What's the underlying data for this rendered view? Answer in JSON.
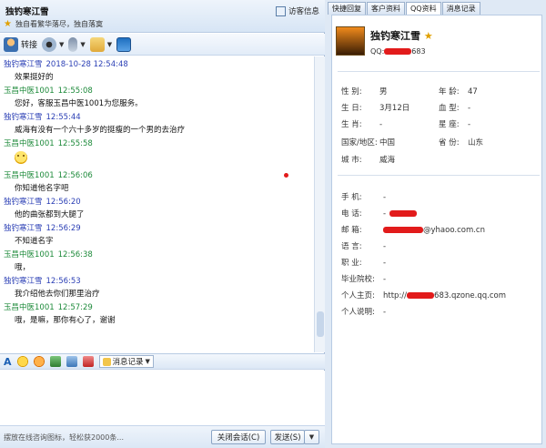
{
  "window": {
    "title": "独钓寒江雪",
    "signature": "独自看繁华落尽，独自落寞",
    "visitor_label": "访客信息"
  },
  "toolbar": {
    "transfer_label": "转接"
  },
  "messages": [
    {
      "sender": "独钓寒江雪",
      "time": "2018-10-28 12:54:48",
      "role": "other",
      "text": "效果挺好的"
    },
    {
      "sender": "玉昌中医1001",
      "time": "12:55:08",
      "role": "self",
      "text": "您好，客服玉昌中医1001为您服务。"
    },
    {
      "sender": "独钓寒江雪",
      "time": "12:55:44",
      "role": "other",
      "text": "威海有没有一个六十多岁的挺瘦的一个男的去治疗"
    },
    {
      "sender": "玉昌中医1001",
      "time": "12:55:58",
      "role": "self",
      "text": ""
    },
    {
      "sender": "玉昌中医1001",
      "time": "12:56:06",
      "role": "self",
      "text": "你知道他名字吧"
    },
    {
      "sender": "独钓寒江雪",
      "time": "12:56:20",
      "role": "other",
      "text": "他的曲张都到大腿了"
    },
    {
      "sender": "独钓寒江雪",
      "time": "12:56:29",
      "role": "other",
      "text": "不知道名字"
    },
    {
      "sender": "玉昌中医1001",
      "time": "12:56:38",
      "role": "self",
      "text": "哦，"
    },
    {
      "sender": "独钓寒江雪",
      "time": "12:56:53",
      "role": "other",
      "text": "我介绍他去你们那里治疗"
    },
    {
      "sender": "玉昌中医1001",
      "time": "12:57:29",
      "role": "self",
      "text": "哦，是嘛，那你有心了，谢谢"
    }
  ],
  "input_toolbar": {
    "history_label": "消息记录"
  },
  "bottom": {
    "ad_text": "摆放在线咨询图标，轻松获2000条...",
    "close_label": "关闭会话(C)",
    "send_label": "发送(S)"
  },
  "tabs": [
    "快捷回复",
    "客户资料",
    "QQ资料",
    "消息记录"
  ],
  "profile": {
    "nickname": "独钓寒江雪",
    "qq_prefix": "QQ:",
    "qq_suffix": "683",
    "gender_label": "性    别:",
    "gender": "男",
    "age_label": "年    龄:",
    "age": "47",
    "birthday_label": "生    日:",
    "birthday": "3月12日",
    "blood_label": "血    型:",
    "blood": "-",
    "zodiac_label": "生    肖:",
    "zodiac": "-",
    "sign_label": "星    座:",
    "sign": "-",
    "country_label": "国家/地区:",
    "country": "中国",
    "province_label": "省    份:",
    "province": "山东",
    "city_label": "城    市:",
    "city": "威海",
    "mobile_label": "手    机:",
    "mobile": "-",
    "phone_label": "电    话:",
    "phone": "-",
    "email_label": "邮    箱:",
    "email_suffix": "@yhaoo.com.cn",
    "lang_label": "语    言:",
    "lang": "-",
    "job_label": "职    业:",
    "job": "-",
    "school_label": "毕业院校:",
    "school": "-",
    "home_label": "个人主页:",
    "home_prefix": "http://",
    "home_suffix": "683.qzone.qq.com",
    "desc_label": "个人说明:",
    "desc": "-"
  },
  "colors": {
    "other_name": "#2b3fb5",
    "self_name": "#1d8a3a",
    "redaction": "#e21b1b"
  }
}
